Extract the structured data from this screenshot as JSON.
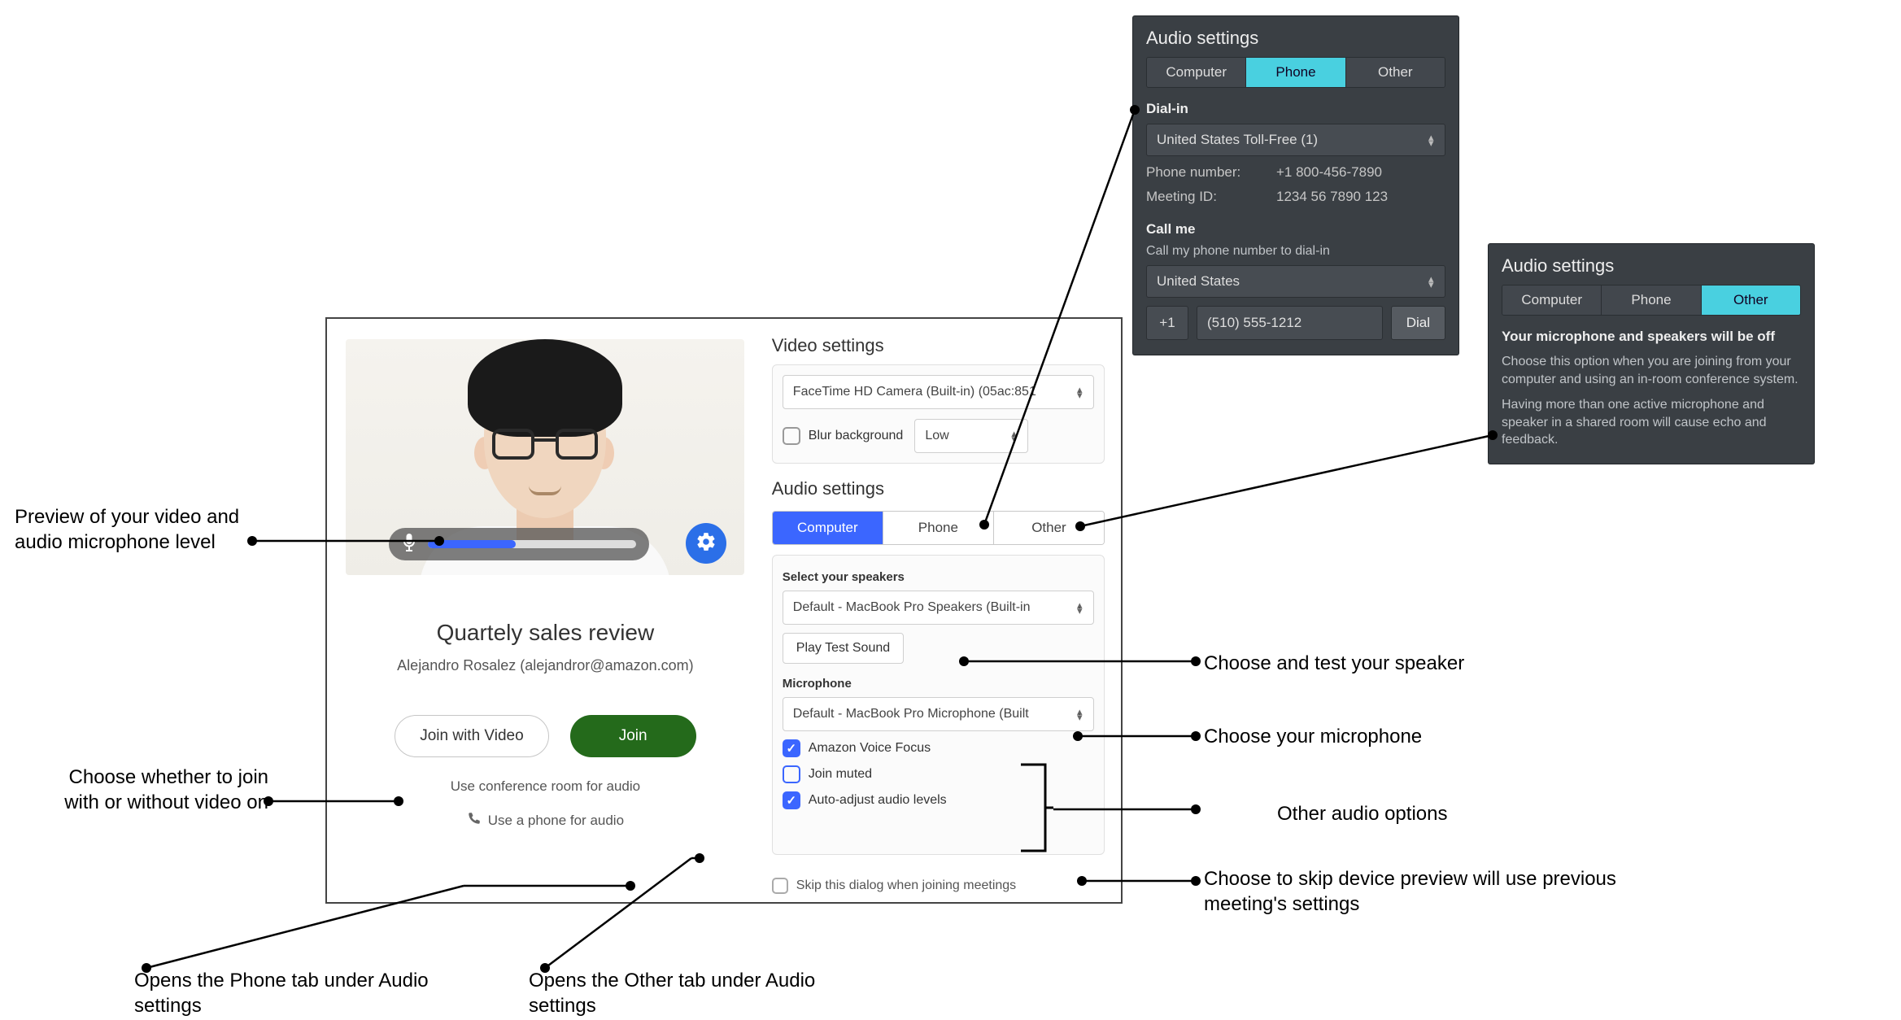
{
  "dialog": {
    "video_settings_title": "Video settings",
    "camera_device": "FaceTime HD Camera (Built-in) (05ac:851",
    "blur_label": "Blur background",
    "blur_level": "Low",
    "audio_settings_title": "Audio settings",
    "tabs": {
      "computer": "Computer",
      "phone": "Phone",
      "other": "Other"
    },
    "speakers_label": "Select your speakers",
    "speakers_device": "Default - MacBook Pro Speakers (Built-in",
    "play_test": "Play Test Sound",
    "mic_label": "Microphone",
    "mic_device": "Default - MacBook Pro Microphone (Built",
    "voice_focus": "Amazon Voice Focus",
    "join_muted": "Join muted",
    "auto_adjust": "Auto-adjust audio levels",
    "skip_dialog": "Skip this dialog when joining meetings",
    "meeting_title": "Quartely sales review",
    "meeting_sub": "Alejandro Rosalez (alejandror@amazon.com)",
    "join_video": "Join with Video",
    "join": "Join",
    "conf_link": "Use conference room for audio",
    "phone_link": "Use a phone for audio"
  },
  "phone_panel": {
    "title": "Audio settings",
    "tabs": {
      "computer": "Computer",
      "phone": "Phone",
      "other": "Other"
    },
    "dialin_label": "Dial-in",
    "country": "United States Toll-Free (1)",
    "phone_k": "Phone number:",
    "phone_v": "+1 800-456-7890",
    "meet_k": "Meeting ID:",
    "meet_v": "1234 56 7890 123",
    "callme_label": "Call me",
    "callme_desc": "Call my phone number to dial-in",
    "callme_country": "United States",
    "cc": "+1",
    "num": "(510) 555-1212",
    "dial": "Dial"
  },
  "other_panel": {
    "title": "Audio settings",
    "tabs": {
      "computer": "Computer",
      "phone": "Phone",
      "other": "Other"
    },
    "strong": "Your microphone and speakers will be off",
    "p1": "Choose this option when you are joining from your computer and using an in-room conference system.",
    "p2": "Having more than one active microphone and speaker in a shared room will cause echo and feedback."
  },
  "callouts": {
    "preview": "Preview of your video and audio microphone level",
    "join_choice": "Choose whether to join with or without video on",
    "opens_phone": "Opens the Phone tab under Audio settings",
    "opens_other": "Opens the Other tab under Audio settings",
    "test_speaker": "Choose and test your speaker",
    "choose_mic": "Choose your microphone",
    "other_audio": "Other audio options",
    "skip": "Choose to skip device preview will use previous meeting's settings"
  }
}
